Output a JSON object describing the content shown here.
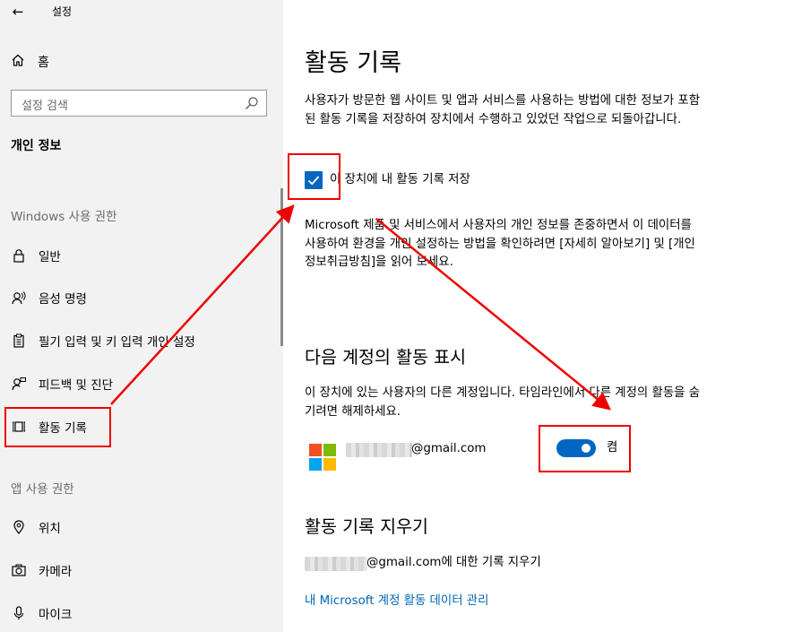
{
  "window": {
    "title": "설정"
  },
  "sidebar": {
    "home_label": "홈",
    "search_placeholder": "설정 검색",
    "section_title": "개인 정보",
    "group_windows": "Windows 사용 권한",
    "group_app": "앱 사용 권한",
    "items": [
      {
        "label": "일반",
        "icon": "lock-icon"
      },
      {
        "label": "음성 명령",
        "icon": "speech-icon"
      },
      {
        "label": "필기 입력 및 키 입력 개인 설정",
        "icon": "clipboard-icon"
      },
      {
        "label": "피드백 및 진단",
        "icon": "feedback-icon"
      },
      {
        "label": "활동 기록",
        "icon": "timeline-icon",
        "selected": true
      },
      {
        "label": "위치",
        "icon": "location-icon"
      },
      {
        "label": "카메라",
        "icon": "camera-icon"
      },
      {
        "label": "마이크",
        "icon": "microphone-icon"
      }
    ]
  },
  "main": {
    "title": "활동 기록",
    "description": "사용자가 방문한 웹 사이트 및 앱과 서비스를 사용하는 방법에 대한 정보가 포함된 활동 기록을 저장하여 장치에서 수행하고 있었던 작업으로 되돌아갑니다.",
    "store_checkbox": {
      "label": "이 장치에 내 활동 기록 저장",
      "checked": true
    },
    "privacy_text": "Microsoft 제품 및 서비스에서 사용자의 개인 정보를 존중하면서 이 데이터를 사용하여 환경을 개인 설정하는 방법을 확인하려면 [자세히 알아보기] 및 [개인정보취급방침]을 읽어 보세요.",
    "accounts_section": {
      "title": "다음 계정의 활동 표시",
      "description": "이 장치에 있는 사용자의 다른 계정입니다. 타임라인에서 다른 계정의 활동을 숨기려면 해제하세요.",
      "account_email_suffix": "@gmail.com",
      "toggle": {
        "state_label": "켬",
        "on": true
      }
    },
    "clear_section": {
      "title": "활동 기록 지우기",
      "email_suffix": "@gmail.com",
      "clear_text": "에 대한 기록 지우기",
      "manage_link": "내 Microsoft 계정 활동 데이터 관리"
    }
  },
  "colors": {
    "accent": "#0067c0",
    "link": "#0066b4",
    "sidebar_bg": "#f2f2f2",
    "annotation_red": "#ee0000",
    "ms_logo": [
      "#f25022",
      "#7fba00",
      "#00a4ef",
      "#ffb900"
    ]
  }
}
